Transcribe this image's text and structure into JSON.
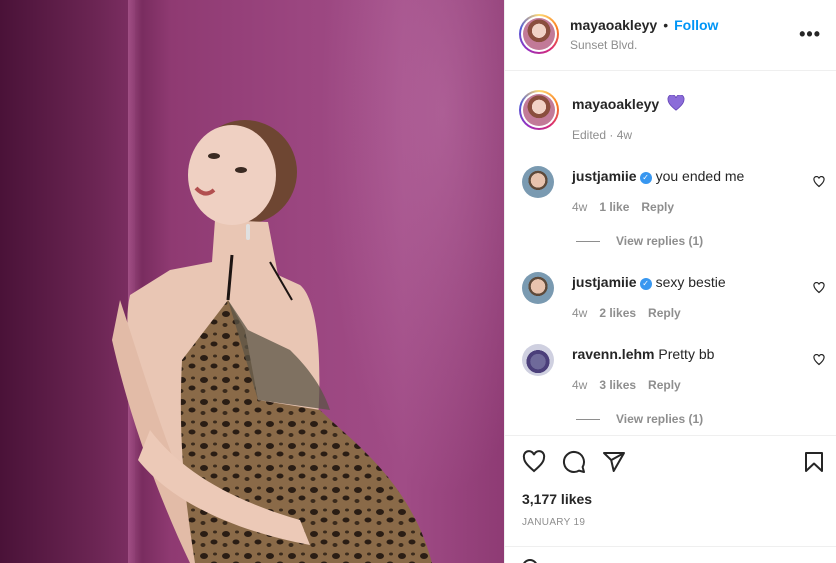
{
  "post": {
    "username": "mayaoakleyy",
    "follow_label": "Follow",
    "separator": "•",
    "location": "Sunset Blvd.",
    "more_label": "•••"
  },
  "caption": {
    "username": "mayaoakleyy",
    "emoji": "purple-heart",
    "meta": "Edited · 4w"
  },
  "comments": [
    {
      "username": "justjamiie",
      "verified": true,
      "text": "you ended me",
      "time": "4w",
      "likes": "1 like",
      "reply": "Reply",
      "view_replies": "View replies (1)"
    },
    {
      "username": "justjamiie",
      "verified": true,
      "text": "sexy bestie",
      "time": "4w",
      "likes": "2 likes",
      "reply": "Reply"
    },
    {
      "username": "ravenn.lehm",
      "verified": false,
      "text": "Pretty bb",
      "time": "4w",
      "likes": "3 likes",
      "reply": "Reply",
      "view_replies": "View replies (1)"
    }
  ],
  "actions": {
    "likes": "3,177 likes",
    "date": "JANUARY 19"
  },
  "colors": {
    "accent": "#0095f6",
    "verified": "#3897f0",
    "muted": "#8e8e8e",
    "text": "#262626",
    "heart_purple": "#8b6cd9"
  }
}
